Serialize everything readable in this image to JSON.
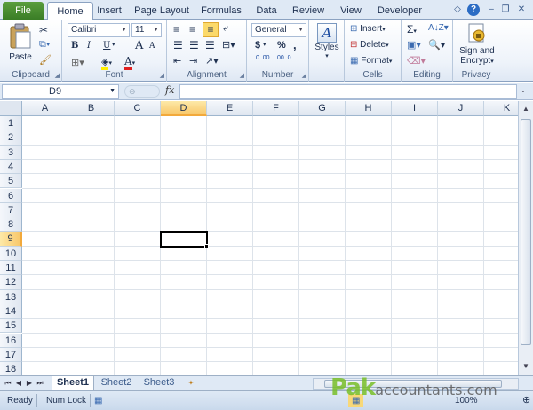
{
  "tabs": {
    "file": "File",
    "items": [
      "Home",
      "Insert",
      "Page Layout",
      "Formulas",
      "Data",
      "Review",
      "View",
      "Developer"
    ],
    "active": "Home"
  },
  "ribbon": {
    "clipboard": {
      "label": "Clipboard",
      "paste": "Paste"
    },
    "font": {
      "label": "Font",
      "name": "Calibri",
      "size": "11",
      "bold": "B",
      "italic": "I",
      "underline": "U",
      "grow": "A",
      "shrink": "A"
    },
    "alignment": {
      "label": "Alignment"
    },
    "number": {
      "label": "Number",
      "format": "General",
      "currency": "$",
      "percent": "%",
      "comma": ",",
      "inc_dec": ".0 .00",
      "dec_dec": ".00 .0"
    },
    "styles": {
      "label": "Styles"
    },
    "cells": {
      "label": "Cells",
      "insert": "Insert",
      "delete": "Delete",
      "format": "Format"
    },
    "editing": {
      "label": "Editing",
      "sum": "Σ"
    },
    "privacy": {
      "label": "Privacy",
      "sign": "Sign and",
      "encrypt": "Encrypt"
    }
  },
  "formula_bar": {
    "name_box": "D9",
    "fx": "fx",
    "value": ""
  },
  "grid": {
    "columns": [
      "A",
      "B",
      "C",
      "D",
      "E",
      "F",
      "G",
      "H",
      "I",
      "J",
      "K"
    ],
    "rows": [
      "1",
      "2",
      "3",
      "4",
      "5",
      "6",
      "7",
      "8",
      "9",
      "10",
      "11",
      "12",
      "13",
      "14",
      "15",
      "16",
      "17",
      "18"
    ],
    "selected_column": "D",
    "selected_row": "9"
  },
  "sheets": {
    "tabs": [
      "Sheet1",
      "Sheet2",
      "Sheet3"
    ],
    "active": "Sheet1"
  },
  "status": {
    "ready": "Ready",
    "numlock": "Num Lock",
    "zoom": "100%"
  },
  "watermark": {
    "pak": "Pak",
    "rest": "accountants.com"
  },
  "colors": {
    "file_tab": "#3a7d26",
    "ribbon_bg": "#dfe9f5",
    "selection": "#f8c76a"
  }
}
